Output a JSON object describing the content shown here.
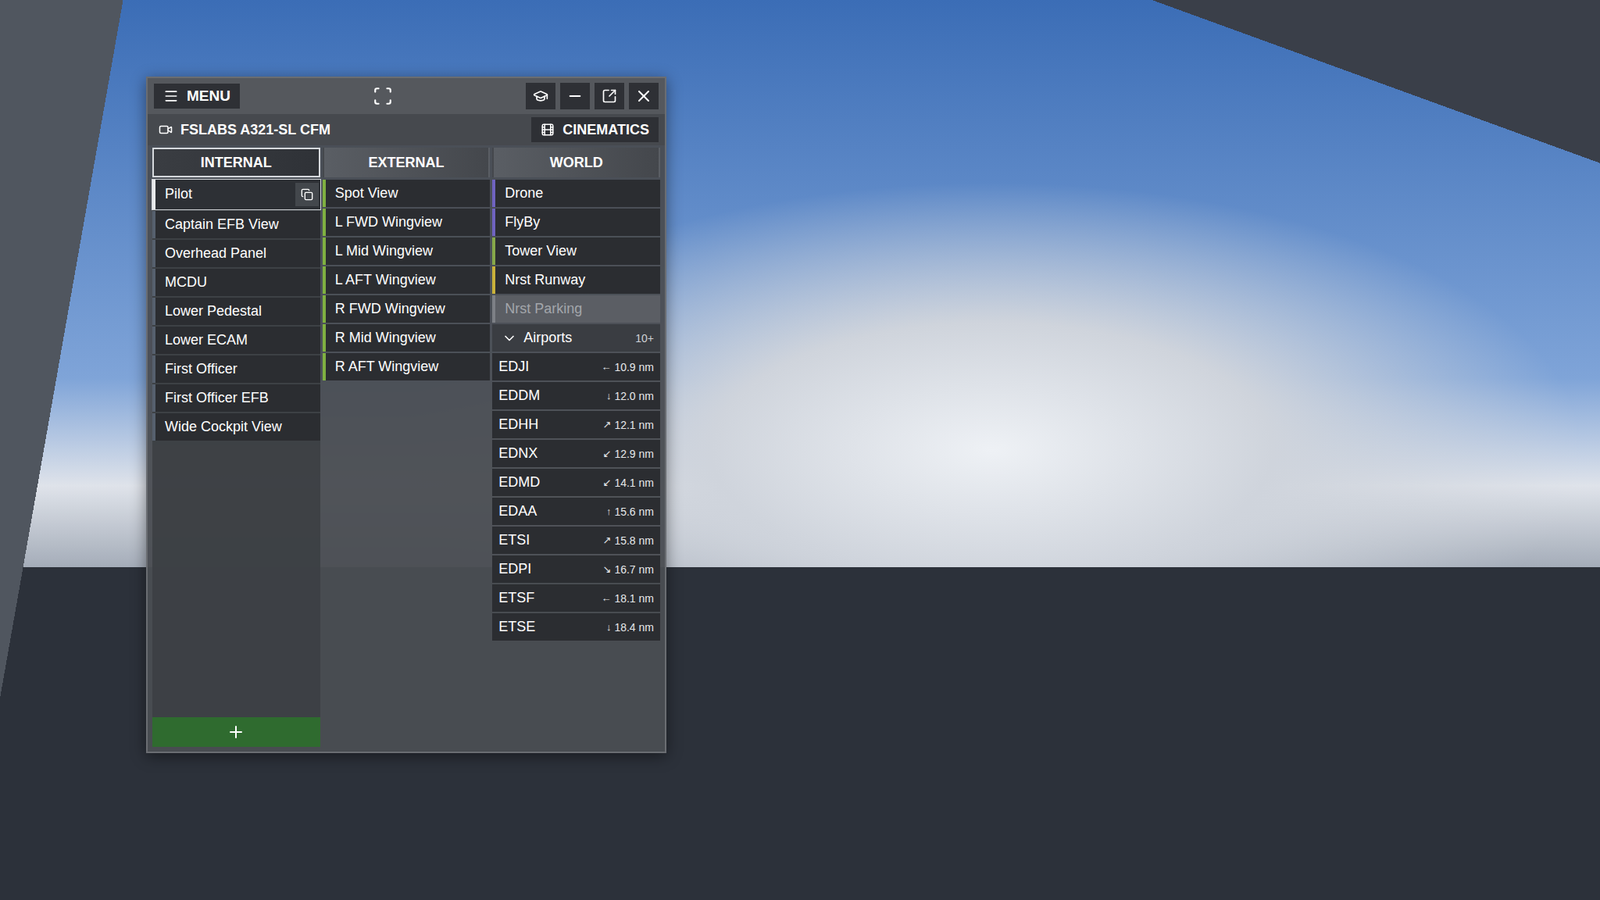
{
  "window": {
    "menu_label": "MENU",
    "aircraft": "FSLABS A321-SL CFM",
    "cinematics": "CINEMATICS"
  },
  "tabs": [
    {
      "label": "INTERNAL",
      "selected": true
    },
    {
      "label": "EXTERNAL",
      "selected": false
    },
    {
      "label": "WORLD",
      "selected": false
    }
  ],
  "internal": [
    {
      "label": "Pilot",
      "selected": true
    },
    {
      "label": "Captain EFB View",
      "selected": false
    },
    {
      "label": "Overhead Panel",
      "selected": false
    },
    {
      "label": "MCDU",
      "selected": false
    },
    {
      "label": "Lower Pedestal",
      "selected": false
    },
    {
      "label": "Lower ECAM",
      "selected": false
    },
    {
      "label": "First Officer",
      "selected": false
    },
    {
      "label": "First Officer EFB",
      "selected": false
    },
    {
      "label": "Wide Cockpit View",
      "selected": false
    }
  ],
  "external": [
    {
      "label": "Spot View",
      "selected": false
    },
    {
      "label": "L FWD Wingview",
      "selected": false
    },
    {
      "label": "L Mid Wingview",
      "selected": false
    },
    {
      "label": "L AFT Wingview",
      "selected": false
    },
    {
      "label": "R FWD Wingview",
      "selected": false
    },
    {
      "label": "R Mid Wingview",
      "selected": false
    },
    {
      "label": "R AFT Wingview",
      "selected": false
    }
  ],
  "world": [
    {
      "label": "Drone",
      "selected": false,
      "disabled": false,
      "color": "#6f63c0"
    },
    {
      "label": "FlyBy",
      "selected": false,
      "disabled": false,
      "color": "#6f63c0"
    },
    {
      "label": "Tower View",
      "selected": false,
      "disabled": false,
      "color": "#86a84a"
    },
    {
      "label": "Nrst Runway",
      "selected": false,
      "disabled": false,
      "color": "#c9b23a"
    },
    {
      "label": "Nrst Parking",
      "selected": false,
      "disabled": true,
      "color": "#7d8086"
    }
  ],
  "airports": {
    "label": "Airports",
    "count": "10+",
    "expanded": true,
    "items": [
      {
        "code": "EDJI",
        "arrow": "←",
        "distance": "10.9 nm"
      },
      {
        "code": "EDDM",
        "arrow": "↓",
        "distance": "12.0 nm"
      },
      {
        "code": "EDHH",
        "arrow": "↗",
        "distance": "12.1 nm"
      },
      {
        "code": "EDNX",
        "arrow": "↙",
        "distance": "12.9 nm"
      },
      {
        "code": "EDMD",
        "arrow": "↙",
        "distance": "14.1 nm"
      },
      {
        "code": "EDAA",
        "arrow": "↑",
        "distance": "15.6 nm"
      },
      {
        "code": "ETSI",
        "arrow": "↗",
        "distance": "15.8 nm"
      },
      {
        "code": "EDPI",
        "arrow": "↘",
        "distance": "16.7 nm"
      },
      {
        "code": "ETSF",
        "arrow": "←",
        "distance": "18.1 nm"
      },
      {
        "code": "ETSE",
        "arrow": "↓",
        "distance": "18.4 nm"
      }
    ]
  }
}
